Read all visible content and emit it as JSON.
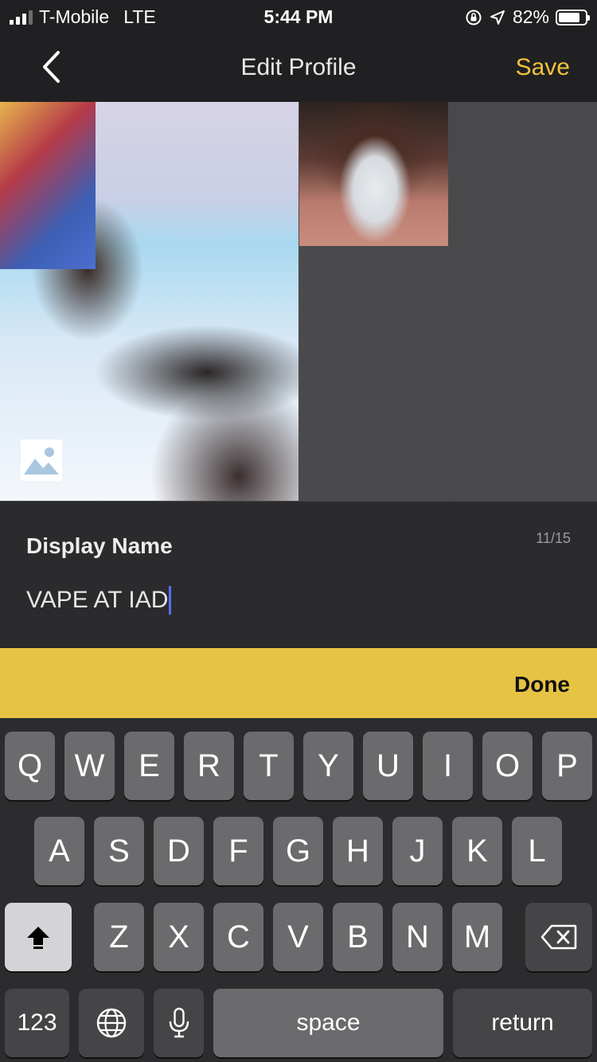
{
  "status_bar": {
    "carrier": "T-Mobile",
    "network": "LTE",
    "time": "5:44 PM",
    "battery_percent": "82%",
    "battery_level": 0.82,
    "signal_bars": 3
  },
  "nav": {
    "title": "Edit Profile",
    "save_label": "Save",
    "back_icon": "chevron-left-icon"
  },
  "photos": {
    "slots": [
      {
        "filled": true
      },
      {
        "filled": true
      },
      {
        "filled": false
      },
      {
        "filled": false
      },
      {
        "filled": false
      }
    ],
    "change_photo_icon": "image-icon"
  },
  "display_name": {
    "label": "Display Name",
    "char_count": "11/15",
    "value": "VAPE AT IAD"
  },
  "toolbar": {
    "done_label": "Done"
  },
  "keyboard": {
    "row1": [
      "Q",
      "W",
      "E",
      "R",
      "T",
      "Y",
      "U",
      "I",
      "O",
      "P"
    ],
    "row2": [
      "A",
      "S",
      "D",
      "F",
      "G",
      "H",
      "J",
      "K",
      "L"
    ],
    "row3": [
      "Z",
      "X",
      "C",
      "V",
      "B",
      "N",
      "M"
    ],
    "numbers_label": "123",
    "space_label": "space",
    "return_label": "return",
    "icons": {
      "shift": "shift-icon",
      "delete": "backspace-icon",
      "globe": "globe-icon",
      "mic": "microphone-icon"
    }
  },
  "colors": {
    "accent": "#f0c23a",
    "toolbar": "#e6c343",
    "caret": "#5b6cff",
    "background": "#2b2b2d"
  }
}
